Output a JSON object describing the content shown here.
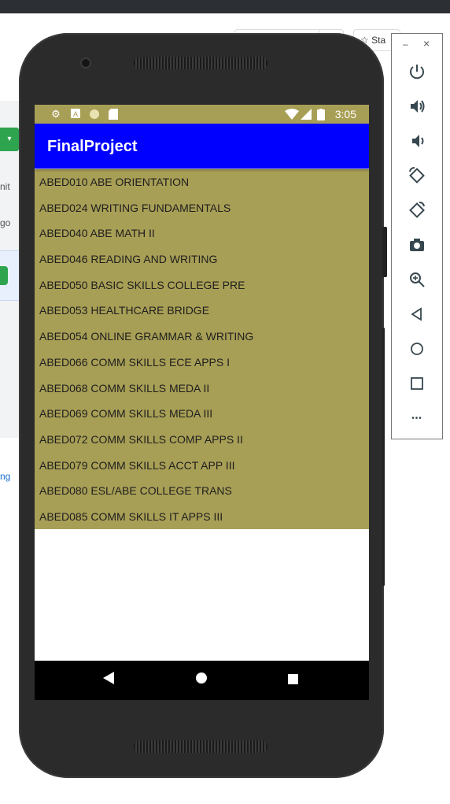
{
  "browser": {
    "star_label": "Sta"
  },
  "background": {
    "btn_glyph": "▾",
    "text_1": "nit",
    "text_2": "go",
    "link_text": "ng"
  },
  "phone": {
    "status_bar": {
      "time": "3:05"
    },
    "app": {
      "title": "FinalProject",
      "courses": [
        "ABED010 ABE ORIENTATION",
        "ABED024 WRITING FUNDAMENTALS",
        "ABED040 ABE MATH II",
        "ABED046 READING AND WRITING",
        "ABED050 BASIC SKILLS COLLEGE PRE",
        "ABED053 HEALTHCARE BRIDGE",
        "ABED054 ONLINE GRAMMAR & WRITING",
        "ABED066 COMM SKILLS ECE APPS I",
        "ABED068 COMM SKILLS MEDA II",
        "ABED069 COMM SKILLS MEDA III",
        "ABED072 COMM SKILLS COMP APPS II",
        "ABED079 COMM SKILLS ACCT APP III",
        "ABED080 ESL/ABE COLLEGE TRANS",
        "ABED085 COMM SKILLS IT APPS III"
      ]
    }
  },
  "emulator_toolbar": {
    "minimize_glyph": "–",
    "close_glyph": "×",
    "more_glyph": "•••",
    "buttons": [
      "power-icon",
      "volume-up-icon",
      "volume-down-icon",
      "rotate-left-icon",
      "rotate-right-icon",
      "camera-icon",
      "zoom-icon",
      "back-icon",
      "home-icon",
      "overview-icon",
      "more-icon"
    ]
  },
  "colors": {
    "app_bar": "#0000ff",
    "list_background": "#a89f56",
    "status_bar": "#a89f56"
  }
}
